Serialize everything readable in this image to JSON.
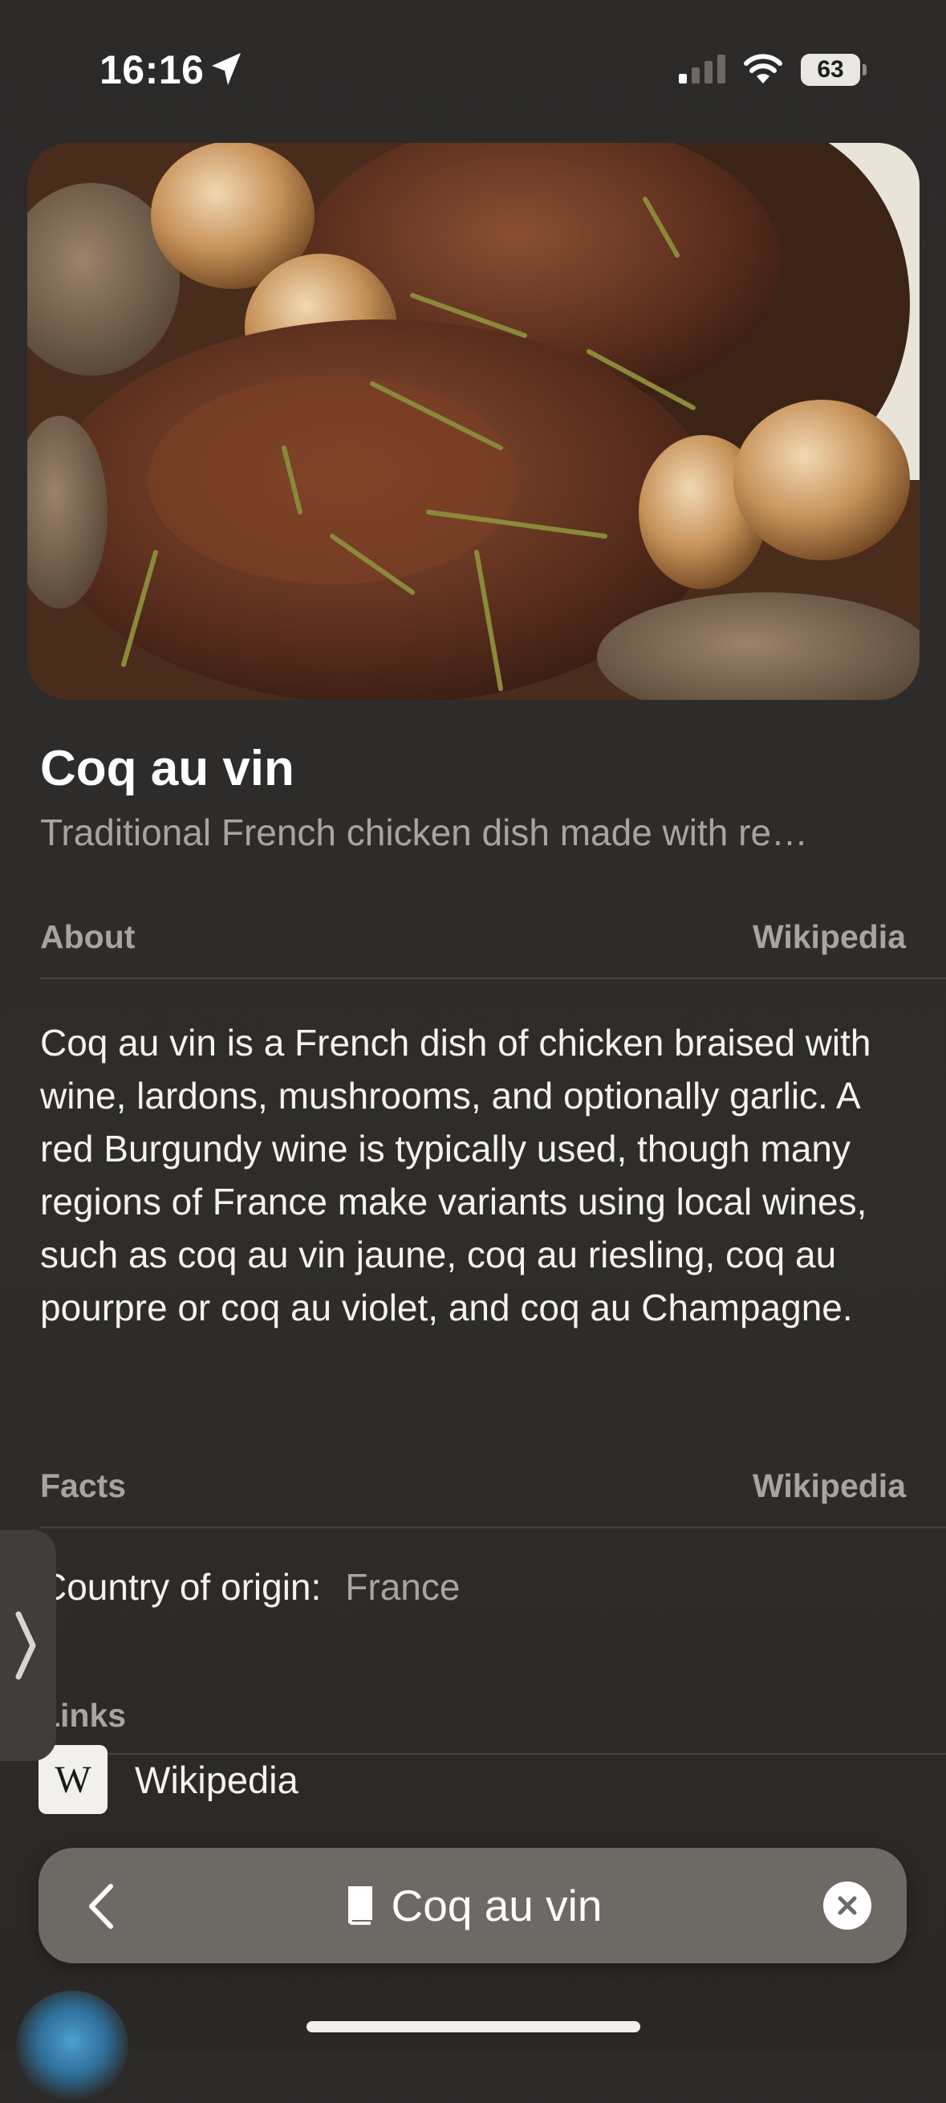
{
  "status_bar": {
    "time": "16:16",
    "battery": "63",
    "icons": [
      "location-arrow-icon",
      "cellular-signal-icon",
      "wifi-icon",
      "battery-icon"
    ]
  },
  "hero_image": {
    "alt": ""
  },
  "header": {
    "title": "Coq au vin",
    "subtitle": "Traditional French chicken dish made with re…"
  },
  "about": {
    "label": "About",
    "source": "Wikipedia",
    "text": "Coq au vin is a French dish of chicken braised with wine, lardons, mushrooms, and optionally garlic. A red Burgundy wine is typically used, though many regions of France make variants using local wines, such as coq au vin jaune, coq au riesling, coq au pourpre or coq au violet, and coq au Champagne."
  },
  "facts": {
    "label": "Facts",
    "source": "Wikipedia",
    "items": [
      {
        "key": "Country of origin:",
        "value": "France"
      }
    ]
  },
  "links": {
    "label": "Links",
    "items": [
      {
        "logo_text": "W",
        "label": "Wikipedia"
      }
    ]
  },
  "bottom_bar": {
    "title": "Coq au vin",
    "icons": [
      "chevron-left-icon",
      "book-icon",
      "close-icon"
    ]
  },
  "colors": {
    "background": "#2e2c2a",
    "secondary_text": "#a8a5a1",
    "bar": "#6d6a66"
  }
}
